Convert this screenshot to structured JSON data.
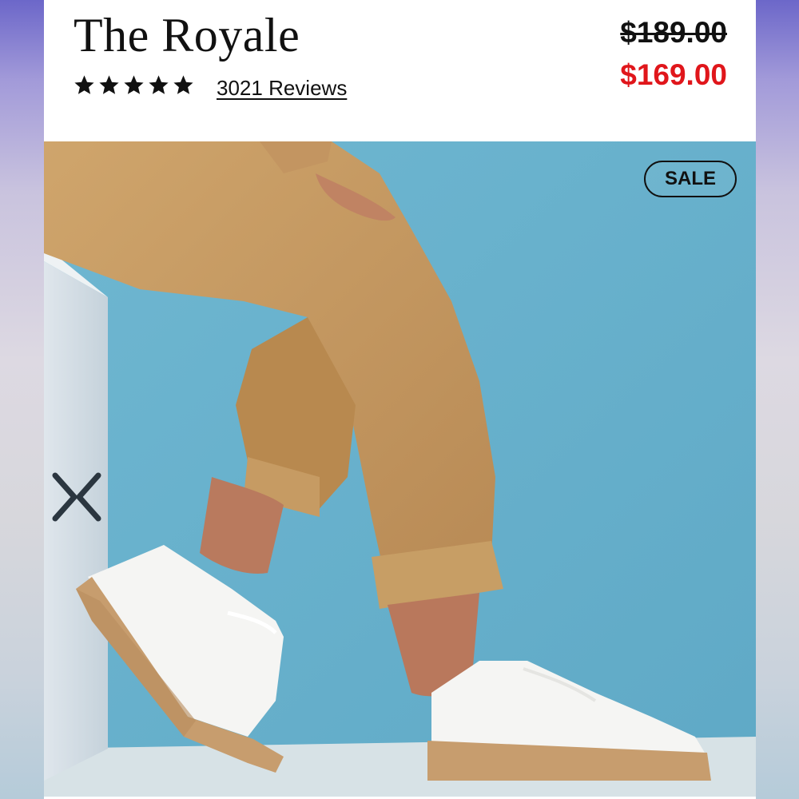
{
  "product": {
    "title": "The Royale",
    "rating_stars": 5,
    "reviews_text": "3021 Reviews",
    "price_original": "$189.00",
    "price_sale": "$169.00"
  },
  "gallery": {
    "badge": "SALE",
    "prev_icon": "chevron-left-icon",
    "next_icon": "chevron-right-icon"
  },
  "colors": {
    "sale_price": "#e0161b",
    "background_wall": "#76bdd6",
    "pants": "#c49a63",
    "sneaker": "#f4f4f2",
    "sole": "#c9a071"
  }
}
